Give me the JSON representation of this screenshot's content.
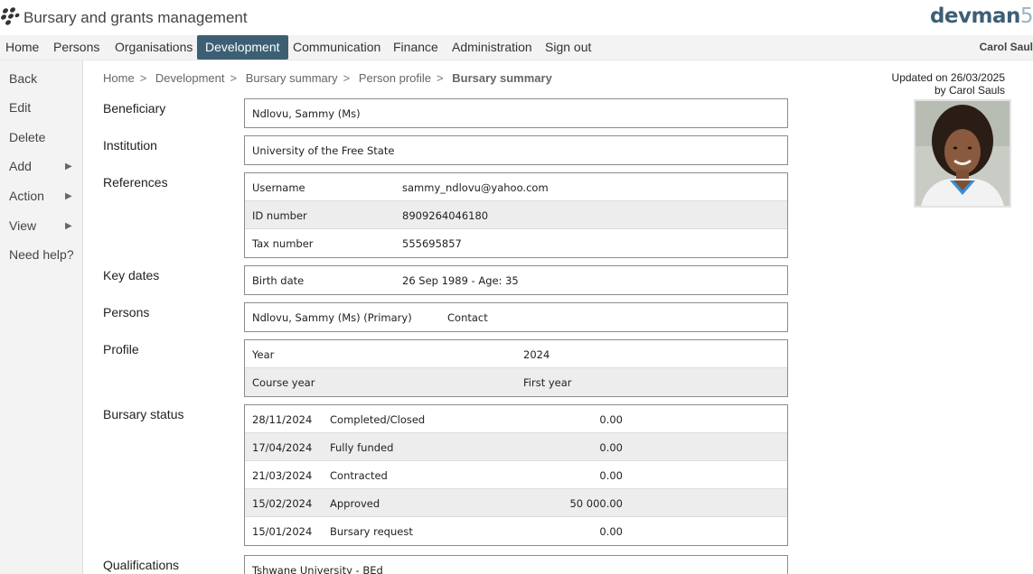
{
  "app": {
    "title": "Bursary and grants management",
    "brand": "devman",
    "brand_suffix": "5"
  },
  "nav": {
    "items": [
      "Home",
      "Persons",
      "Organisations",
      "Development",
      "Communication",
      "Finance",
      "Administration",
      "Sign out"
    ],
    "active": "Development",
    "user": "Carol Saul"
  },
  "sidebar": {
    "back": "Back",
    "edit": "Edit",
    "delete": "Delete",
    "add": "Add",
    "action": "Action",
    "view": "View",
    "help": "Need help?"
  },
  "breadcrumb": [
    "Home",
    "Development",
    "Bursary summary",
    "Person profile",
    "Bursary summary"
  ],
  "updated": {
    "line1": "Updated on 26/03/2025",
    "line2": "by Carol Sauls"
  },
  "sections": {
    "beneficiary": {
      "label": "Beneficiary",
      "value": "Ndlovu, Sammy (Ms)"
    },
    "institution": {
      "label": "Institution",
      "value": "University of the Free State"
    },
    "references": {
      "label": "References",
      "rows": [
        {
          "key": "Username",
          "value": "sammy_ndlovu@yahoo.com"
        },
        {
          "key": "ID number",
          "value": "8909264046180"
        },
        {
          "key": "Tax number",
          "value": "555695857"
        }
      ]
    },
    "key_dates": {
      "label": "Key dates",
      "rows": [
        {
          "key": "Birth date",
          "value": "26 Sep 1989 - Age: 35"
        }
      ]
    },
    "persons": {
      "label": "Persons",
      "name": "Ndlovu, Sammy (Ms) (Primary)",
      "role": "Contact"
    },
    "profile": {
      "label": "Profile",
      "rows": [
        {
          "key": "Year",
          "value": "2024"
        },
        {
          "key": "Course year",
          "value": "First year"
        }
      ]
    },
    "bursary_status": {
      "label": "Bursary status",
      "rows": [
        {
          "date": "28/11/2024",
          "status": "Completed/Closed",
          "amount": "0.00"
        },
        {
          "date": "17/04/2024",
          "status": "Fully funded",
          "amount": "0.00"
        },
        {
          "date": "21/03/2024",
          "status": "Contracted",
          "amount": "0.00"
        },
        {
          "date": "15/02/2024",
          "status": "Approved",
          "amount": "50 000.00"
        },
        {
          "date": "15/01/2024",
          "status": "Bursary request",
          "amount": "0.00"
        }
      ]
    },
    "qualifications": {
      "label": "Qualifications",
      "value": "Tshwane University - BEd"
    }
  }
}
